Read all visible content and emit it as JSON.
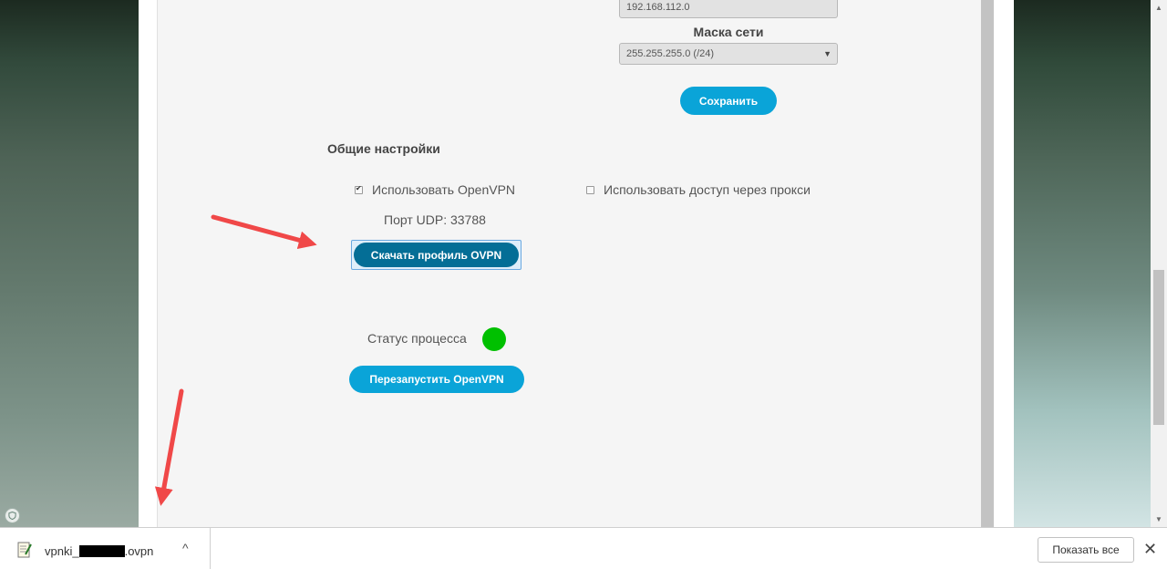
{
  "network": {
    "ip_value": "192.168.112.0",
    "mask_label": "Маска сети",
    "mask_value": "255.255.255.0 (/24)",
    "save_label": "Сохранить"
  },
  "general": {
    "title": "Общие настройки",
    "use_openvpn": {
      "label": "Использовать OpenVPN",
      "checked": true
    },
    "use_proxy": {
      "label": "Использовать доступ через прокси",
      "checked": false
    },
    "udp_port": "Порт UDP: 33788",
    "download_label": "Скачать профиль OVPN",
    "status_label": "Статус процесса",
    "status_color": "#00c000",
    "restart_label": "Перезапустить OpenVPN"
  },
  "downloads_bar": {
    "file_prefix": "vpnki_",
    "file_suffix": ".ovpn",
    "show_all_label": "Показать все",
    "close_symbol": "✕",
    "menu_symbol": "^"
  },
  "annotations": {
    "arrow_color": "#f04848"
  }
}
